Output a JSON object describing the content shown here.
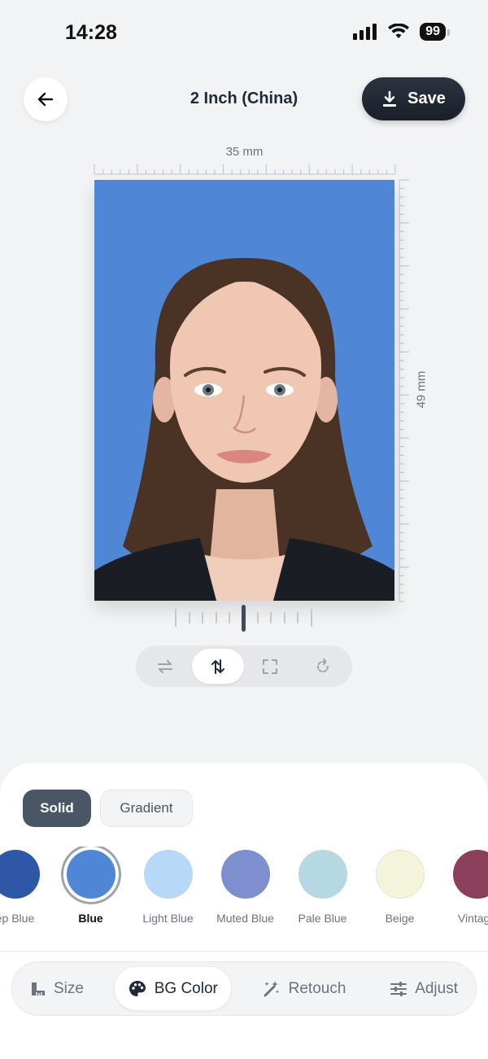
{
  "status": {
    "time": "14:28",
    "battery": "99"
  },
  "header": {
    "title": "2 Inch (China)",
    "save_label": "Save"
  },
  "photo": {
    "width_label": "35 mm",
    "height_label": "49 mm",
    "background_color": "#4f87d6"
  },
  "bg_mode": {
    "solid_label": "Solid",
    "gradient_label": "Gradient",
    "selected": "Solid"
  },
  "swatches": [
    {
      "name": "Deep Blue",
      "visible_text": "ep Blue",
      "color": "#2f57a8"
    },
    {
      "name": "Blue",
      "visible_text": "Blue",
      "color": "#4f87d6"
    },
    {
      "name": "Light Blue",
      "visible_text": "Light Blue",
      "color": "#b8d8f7"
    },
    {
      "name": "Muted Blue",
      "visible_text": "Muted Blue",
      "color": "#7d8fcf"
    },
    {
      "name": "Pale Blue",
      "visible_text": "Pale Blue",
      "color": "#b5d8e3"
    },
    {
      "name": "Beige",
      "visible_text": "Beige",
      "color": "#f4f4dc"
    },
    {
      "name": "Vintage",
      "visible_text": "Vintage",
      "color": "#8b3f5a"
    }
  ],
  "tabs": [
    {
      "label": "Size",
      "icon": "ruler-icon"
    },
    {
      "label": "BG Color",
      "icon": "palette-icon"
    },
    {
      "label": "Retouch",
      "icon": "magic-wand-icon"
    },
    {
      "label": "Adjust",
      "icon": "sliders-icon"
    }
  ],
  "active_tab": "BG Color"
}
